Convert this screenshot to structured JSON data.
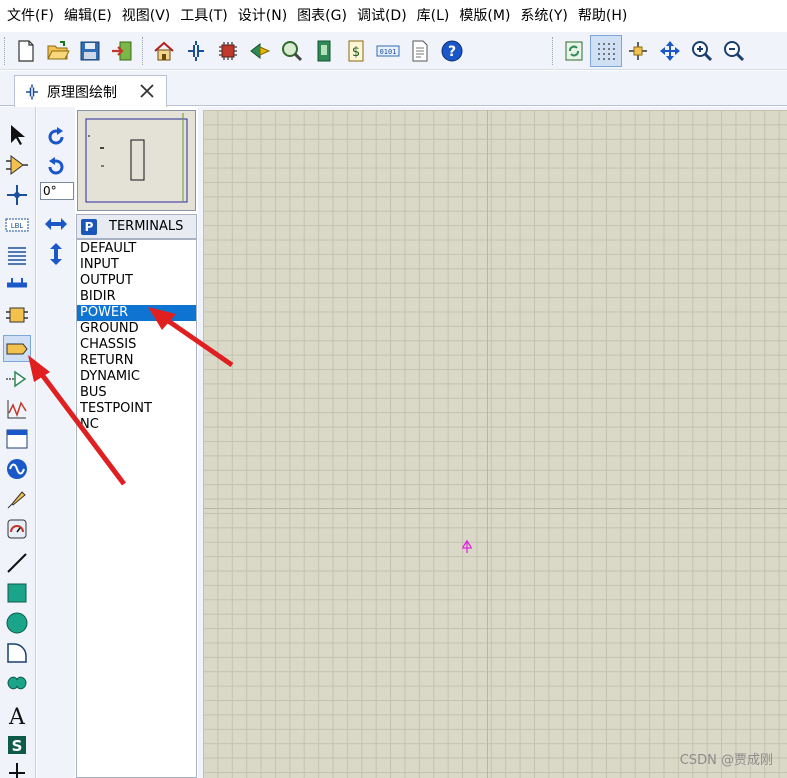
{
  "menu": [
    "文件(F)",
    "编辑(E)",
    "视图(V)",
    "工具(T)",
    "设计(N)",
    "图表(G)",
    "调试(D)",
    "库(L)",
    "模版(M)",
    "系统(Y)",
    "帮助(H)"
  ],
  "toolbar_icons": [
    "new-file-icon",
    "open-folder-icon",
    "save-icon",
    "import-icon",
    "home-icon",
    "schematic-icon",
    "chip-icon",
    "3d-icon",
    "zoom-inspect-icon",
    "bom-icon",
    "dollar-icon",
    "binary-icon",
    "document-icon",
    "help-icon",
    "refresh-icon",
    "grid-icon",
    "origin-icon",
    "pan-icon",
    "zoom-in-icon",
    "zoom-out-icon"
  ],
  "tab": {
    "label": "原理图绘制",
    "icon": "schematic-icon"
  },
  "mode_tools": [
    "selection-icon",
    "component-icon",
    "junction-icon",
    "wire-label-icon",
    "text-script-icon",
    "bus-icon",
    "subcircuit-icon",
    "terminal-icon",
    "device-pin-icon",
    "graph-icon",
    "tape-icon",
    "generator-icon",
    "probe-icon",
    "instrument-icon",
    "line-icon",
    "box-icon",
    "circle-icon",
    "arc-icon",
    "path-icon",
    "text-icon",
    "symbol-icon",
    "marker-icon"
  ],
  "rotation": {
    "angle": "0°"
  },
  "terminals": {
    "badge": "P",
    "title": "TERMINALS",
    "items": [
      "DEFAULT",
      "INPUT",
      "OUTPUT",
      "BIDIR",
      "POWER",
      "GROUND",
      "CHASSIS",
      "RETURN",
      "DYNAMIC",
      "BUS",
      "TESTPOINT",
      "NC"
    ],
    "selected": "POWER"
  },
  "watermark": "CSDN @贾成刚",
  "colors": {
    "selection": "#0f73d2",
    "canvas": "#dad8c6",
    "annotation_arrow": "#e02020",
    "origin_marker": "#e020e0"
  }
}
